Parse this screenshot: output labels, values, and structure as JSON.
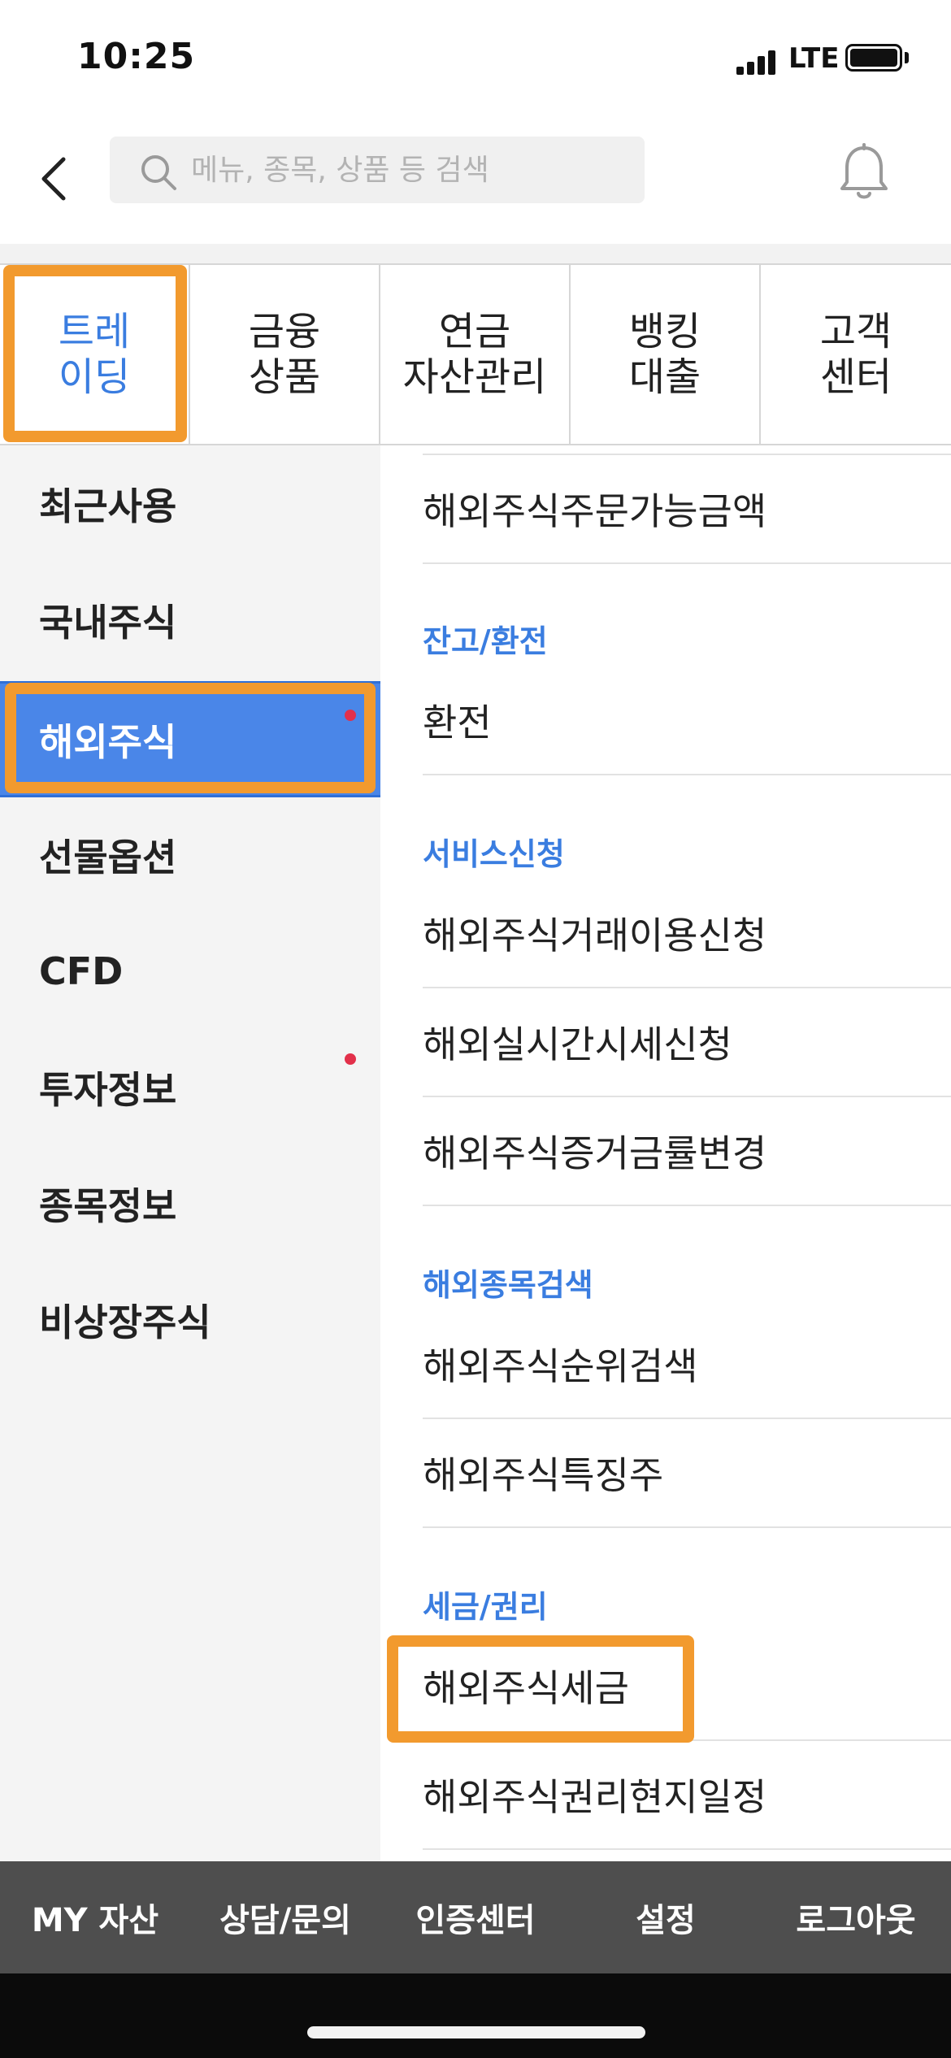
{
  "status_bar": {
    "time": "10:25",
    "network": "LTE"
  },
  "header": {
    "search_placeholder": "메뉴, 종목, 상품 등 검색"
  },
  "top_tabs": [
    {
      "label": "트레\n이딩",
      "active": true
    },
    {
      "label": "금융\n상품",
      "active": false
    },
    {
      "label": "연금\n자산관리",
      "active": false
    },
    {
      "label": "뱅킹\n대출",
      "active": false
    },
    {
      "label": "고객\n센터",
      "active": false
    }
  ],
  "left_menu": [
    {
      "label": "최근사용"
    },
    {
      "label": "국내주식"
    },
    {
      "label": "해외주식",
      "active": true,
      "dot": true
    },
    {
      "label": "선물옵션"
    },
    {
      "label": "CFD"
    },
    {
      "label": "투자정보",
      "dot": true
    },
    {
      "label": "종목정보"
    },
    {
      "label": "비상장주식"
    }
  ],
  "right_panel": {
    "items": [
      {
        "label": "해외주식주문가능금액"
      },
      {
        "section": "잔고/환전"
      },
      {
        "label": "환전"
      },
      {
        "section": "서비스신청"
      },
      {
        "label": "해외주식거래이용신청"
      },
      {
        "label": "해외실시간시세신청"
      },
      {
        "label": "해외주식증거금률변경"
      },
      {
        "section": "해외종목검색"
      },
      {
        "label": "해외주식순위검색"
      },
      {
        "label": "해외주식특징주"
      },
      {
        "section": "세금/권리"
      },
      {
        "label": "해외주식세금"
      },
      {
        "label": "해외주식권리현지일정"
      }
    ]
  },
  "bottom_bar": [
    "MY 자산",
    "상담/문의",
    "인증센터",
    "설정",
    "로그아웃"
  ],
  "colors": {
    "accent": "#3a7de0",
    "active_bg": "#4a86e8",
    "highlight": "#f29a2e",
    "bottom_bar": "#4e4e4e",
    "dot": "#e2304a"
  }
}
